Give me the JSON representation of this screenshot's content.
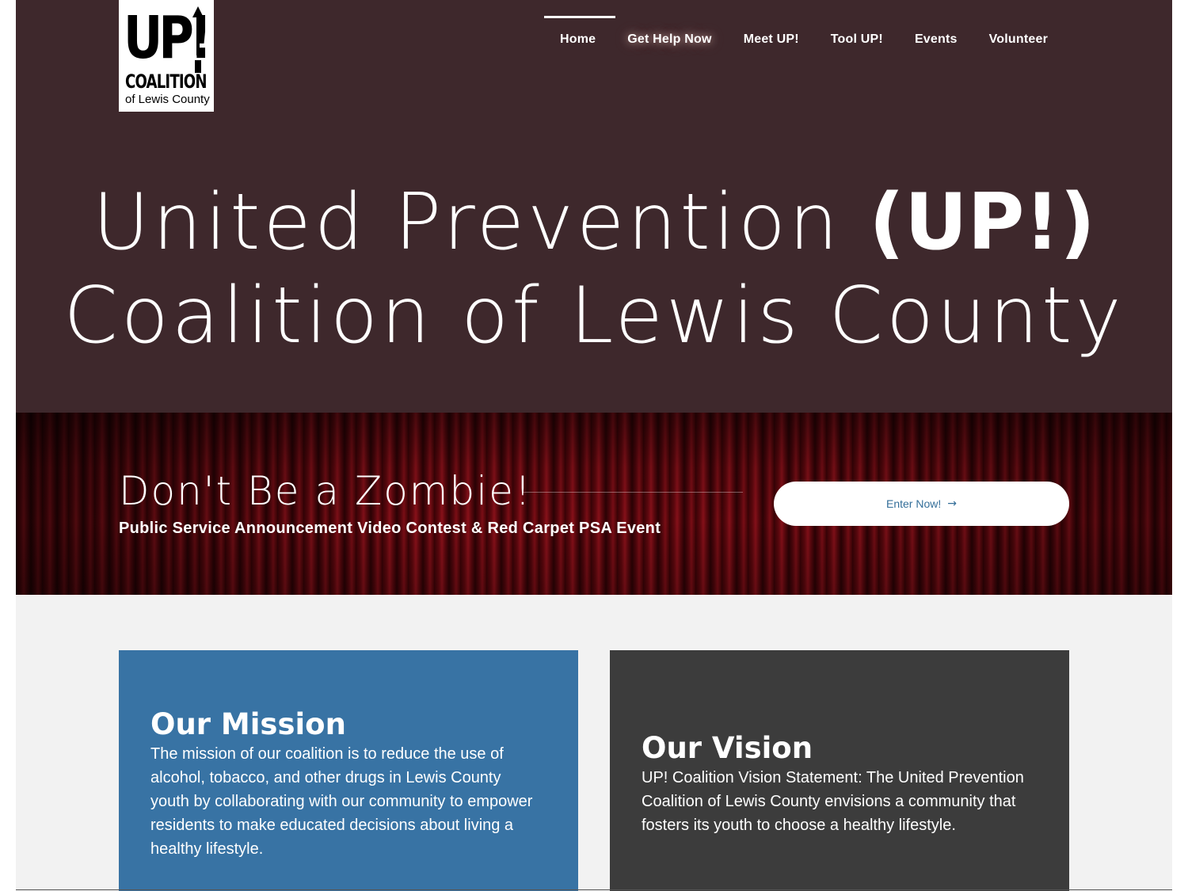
{
  "header": {
    "logo": {
      "top_text": "UP!",
      "middle_text": "COALITION",
      "bottom_text": "of Lewis County",
      "arrow_icon": "up-arrow-icon"
    },
    "nav": [
      {
        "label": "Home",
        "active": true
      },
      {
        "label": "Get Help Now",
        "highlighted": true
      },
      {
        "label": "Meet UP!"
      },
      {
        "label": "Tool UP!"
      },
      {
        "label": "Events"
      },
      {
        "label": "Volunteer"
      }
    ]
  },
  "hero": {
    "line1_light": "United Prevention ",
    "line1_bold": "(UP!)",
    "line2": "Coalition of Lewis County"
  },
  "promo": {
    "headline": "Don't Be a Zombie!",
    "subheadline": "Public Service Announcement Video Contest & Red Carpet PSA Event",
    "button_label": "Enter Now!",
    "button_icon": "arrow-right-icon"
  },
  "mission": {
    "title": "Our Mission",
    "body": "The mission of our coalition is to reduce the use of alcohol, tobacco, and other drugs in Lewis County youth by collaborating with our community to empower residents to make educated decisions about living a healthy lifestyle."
  },
  "vision": {
    "title": "Our Vision",
    "body": "UP! Coalition Vision Statement: The United Prevention Coalition of Lewis County envisions a community that fosters its youth to choose a healthy lifestyle."
  },
  "colors": {
    "hero_bg": "#3e282c",
    "mission_bg": "#3873a4",
    "vision_bg": "#3c3c3c",
    "section_bg": "#f2f2f2",
    "button_text": "#336e99"
  }
}
